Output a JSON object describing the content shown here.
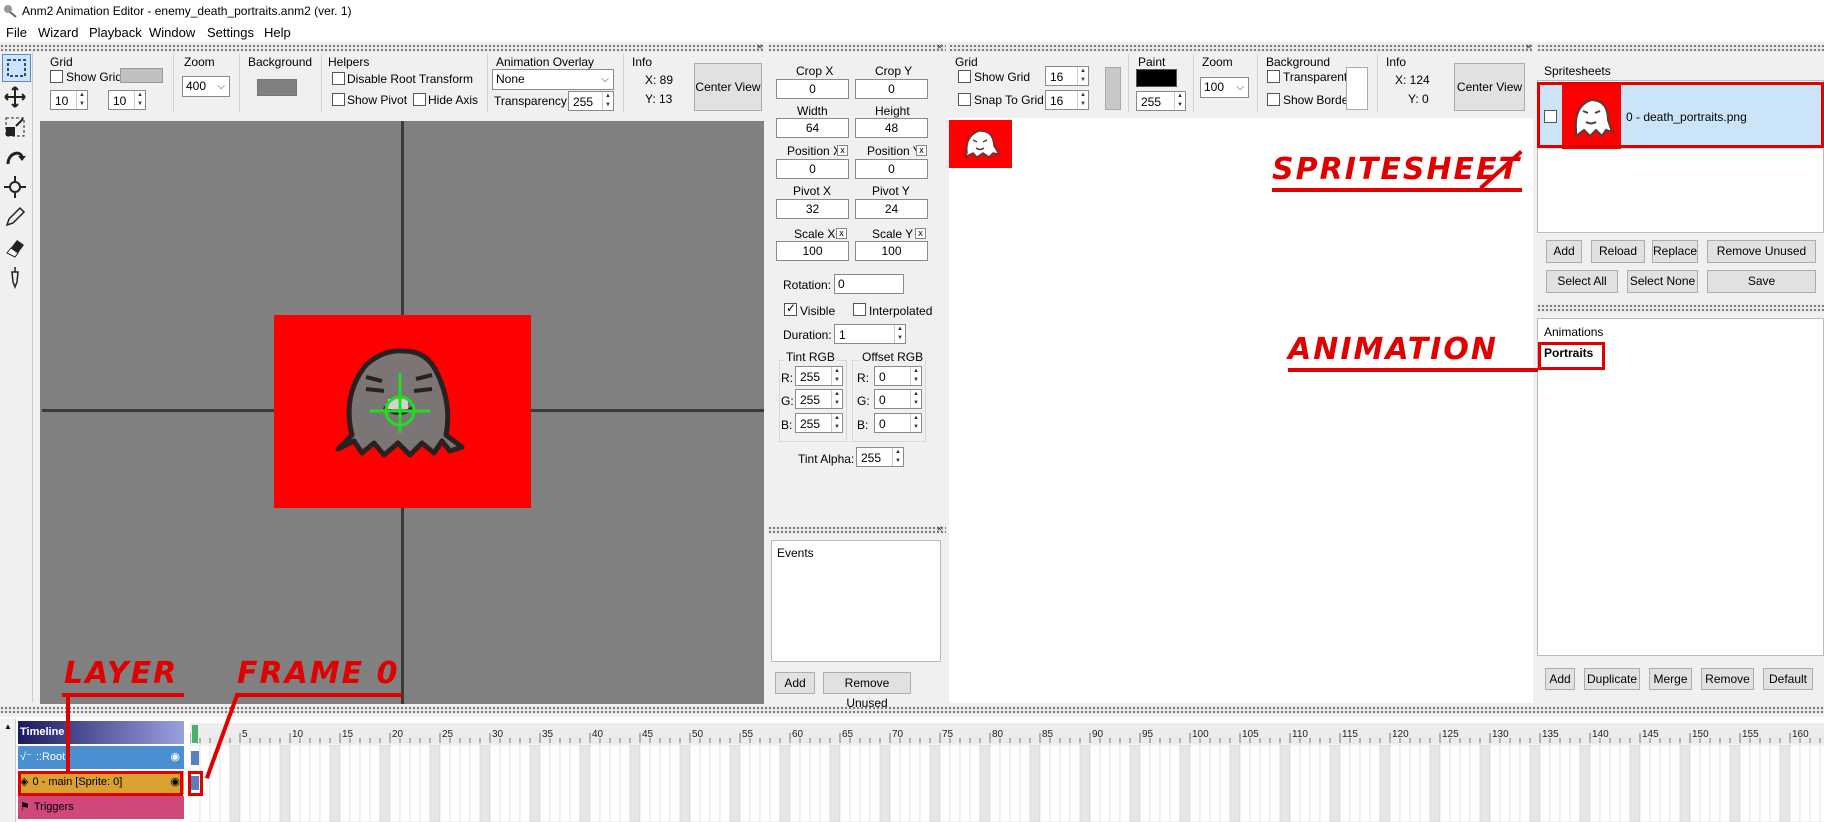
{
  "window": {
    "title": "Anm2 Animation Editor - enemy_death_portraits.anm2 (ver. 1)"
  },
  "menu": [
    "File",
    "Wizard",
    "Playback",
    "Window",
    "Settings",
    "Help"
  ],
  "animation_preview": {
    "grid": {
      "label": "Grid",
      "show_grid": "Show Grid",
      "w": "10",
      "h": "10"
    },
    "zoom": {
      "label": "Zoom",
      "value": "400"
    },
    "background": {
      "label": "Background"
    },
    "helpers": {
      "label": "Helpers",
      "disable_root": "Disable Root Transform",
      "show_pivot": "Show Pivot",
      "hide_axis": "Hide Axis"
    },
    "overlay": {
      "label": "Animation Overlay",
      "value": "None",
      "transparency_label": "Transparency:",
      "transparency": "255"
    },
    "info": {
      "label": "Info",
      "x": "X: 89",
      "y": "Y: 13"
    },
    "center_view": "Center View"
  },
  "frame_properties": {
    "crop_x": {
      "label": "Crop X",
      "value": "0"
    },
    "crop_y": {
      "label": "Crop Y",
      "value": "0"
    },
    "width": {
      "label": "Width",
      "value": "64"
    },
    "height": {
      "label": "Height",
      "value": "48"
    },
    "pos_x": {
      "label": "Position X",
      "value": "0"
    },
    "pos_y": {
      "label": "Position Y",
      "value": "0"
    },
    "pivot_x": {
      "label": "Pivot X",
      "value": "32"
    },
    "pivot_y": {
      "label": "Pivot Y",
      "value": "24"
    },
    "scale_x": {
      "label": "Scale X",
      "value": "100"
    },
    "scale_y": {
      "label": "Scale Y",
      "value": "100"
    },
    "x_mark": "x",
    "rotation": {
      "label": "Rotation:",
      "value": "0"
    },
    "visible": "Visible",
    "interpolated": "Interpolated",
    "duration": {
      "label": "Duration:",
      "value": "1"
    },
    "tint": {
      "label": "Tint RGB",
      "r_label": "R:",
      "g_label": "G:",
      "b_label": "B:",
      "r": "255",
      "g": "255",
      "b": "255"
    },
    "offset": {
      "label": "Offset RGB",
      "r_label": "R:",
      "g_label": "G:",
      "b_label": "B:",
      "r": "0",
      "g": "0",
      "b": "0"
    },
    "tint_alpha": {
      "label": "Tint Alpha:",
      "value": "255"
    }
  },
  "events": {
    "label": "Events",
    "add": "Add",
    "remove_unused": "Remove Unused"
  },
  "spritesheet_editor": {
    "grid": {
      "label": "Grid",
      "show_grid": "Show Grid",
      "snap": "Snap To Grid",
      "w": "16",
      "h": "16"
    },
    "paint": {
      "label": "Paint",
      "alpha": "255"
    },
    "zoom": {
      "label": "Zoom",
      "value": "100"
    },
    "background": {
      "label": "Background",
      "transparent": "Transparent",
      "show_border": "Show Border"
    },
    "info": {
      "label": "Info",
      "x": "X: 124",
      "y": "Y: 0"
    },
    "center_view": "Center View"
  },
  "spritesheets": {
    "label": "Spritesheets",
    "items": [
      {
        "name": "0 - death_portraits.png"
      }
    ],
    "buttons": {
      "add": "Add",
      "reload": "Reload",
      "replace": "Replace",
      "remove_unused": "Remove Unused",
      "select_all": "Select All",
      "select_none": "Select None",
      "save": "Save"
    }
  },
  "animations": {
    "label": "Animations",
    "items": [
      {
        "name": "Portraits"
      }
    ],
    "buttons": {
      "add": "Add",
      "duplicate": "Duplicate",
      "merge": "Merge",
      "remove": "Remove",
      "default": "Default"
    }
  },
  "timeline": {
    "header": "Timeline",
    "rows": [
      {
        "label": "::Root",
        "color": "#4a90d0"
      },
      {
        "label": "0 - main [Sprite: 0]",
        "color": "#d9a032"
      },
      {
        "label": "Triggers",
        "color": "#d0477a"
      }
    ],
    "ticks": [
      "5",
      "10",
      "15",
      "20",
      "25",
      "30",
      "35",
      "40",
      "45",
      "50",
      "55",
      "60",
      "65",
      "70",
      "75",
      "80",
      "85",
      "90",
      "95",
      "100",
      "105",
      "110",
      "115",
      "120",
      "125",
      "130",
      "135",
      "140",
      "145",
      "150",
      "155",
      "160"
    ]
  },
  "annotations": {
    "spritesheet": "SPRITESHEET",
    "animation": "ANIMATION",
    "layer": "LAYER",
    "frame0": "FRAME 0"
  },
  "colors": {
    "accent_red": "#e00000",
    "canvas_bg": "#808080",
    "frame_fill": "#ff0000",
    "selection": "#cce4f7"
  }
}
